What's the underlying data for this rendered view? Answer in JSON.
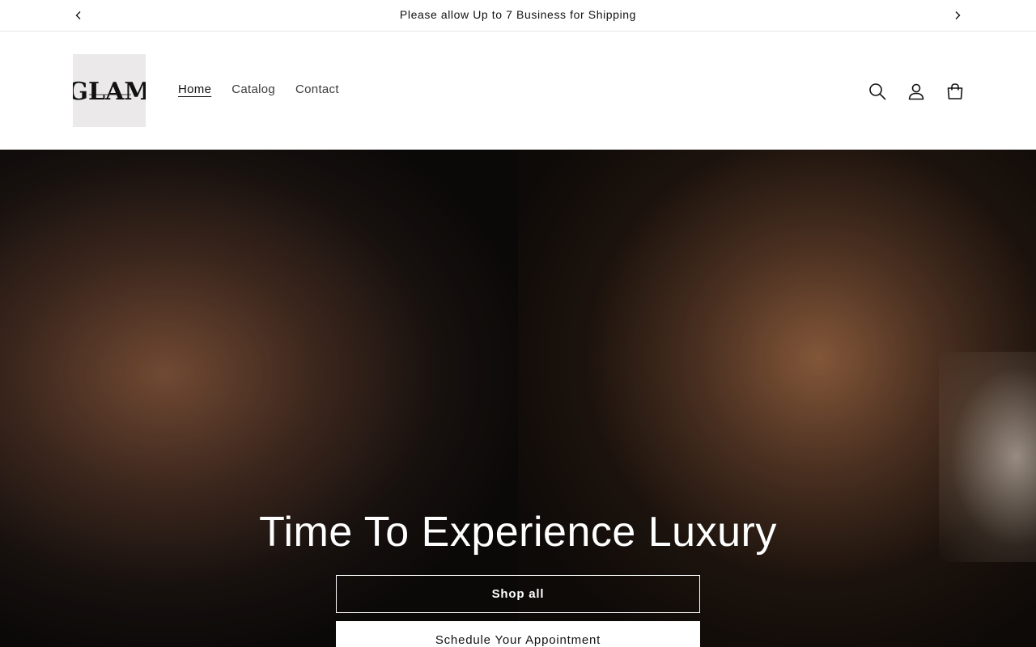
{
  "announcement": {
    "text": "Please allow Up to 7 Business for Shipping",
    "prev_icon": "chevron-left-icon",
    "next_icon": "chevron-right-icon"
  },
  "header": {
    "logo_text": "GLAM",
    "nav": [
      {
        "label": "Home",
        "active": true
      },
      {
        "label": "Catalog",
        "active": false
      },
      {
        "label": "Contact",
        "active": false
      }
    ],
    "icons": [
      "search-icon",
      "account-icon",
      "cart-icon"
    ]
  },
  "hero": {
    "heading": "Time To Experience Luxury",
    "primary_button": "Shop all",
    "secondary_button": "Schedule Your Appointment"
  },
  "colors": {
    "text": "#121212",
    "background": "#ffffff",
    "logo_bg": "#ebe9e9"
  }
}
